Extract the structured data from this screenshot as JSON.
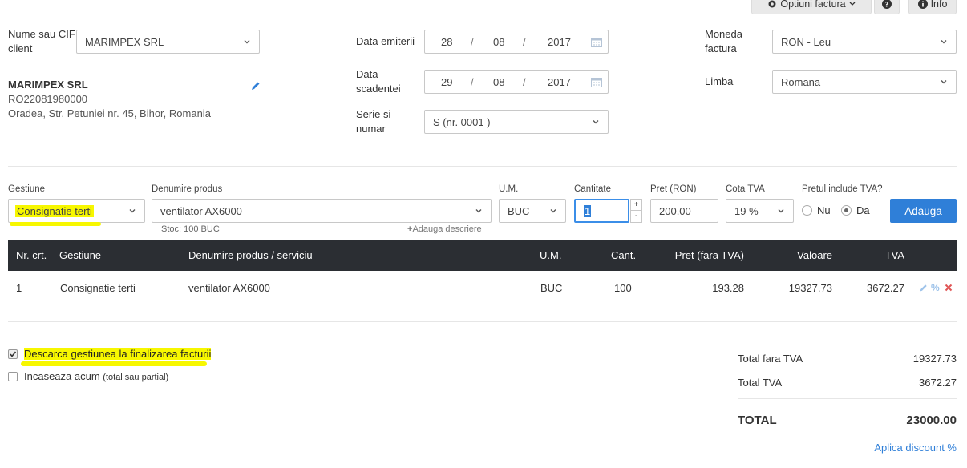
{
  "top": {
    "optiuni_label": "Optiuni factura",
    "info_label": "Info"
  },
  "client": {
    "label_line1": "Nume sau CIF",
    "label_line2": "client",
    "selected": "MARIMPEX SRL",
    "name": "MARIMPEX SRL",
    "cif": "RO22081980000",
    "address": "Oradea, Str. Petuniei nr. 45, Bihor, Romania"
  },
  "dates": {
    "emiterii_label": "Data emiterii",
    "emiterii": {
      "day": "28",
      "month": "08",
      "year": "2017"
    },
    "scadentei_label_line1": "Data",
    "scadentei_label_line2": "scadentei",
    "scadentei": {
      "day": "29",
      "month": "08",
      "year": "2017"
    },
    "sep": "/"
  },
  "serie": {
    "label_line1": "Serie si",
    "label_line2": "numar",
    "value": "S (nr. 0001 )"
  },
  "moneda": {
    "label_line1": "Moneda",
    "label_line2": "factura",
    "value": "RON - Leu"
  },
  "limba": {
    "label": "Limba",
    "value": "Romana"
  },
  "product_form": {
    "gestiune_label": "Gestiune",
    "gestiune_value": "Consignatie terti",
    "denumire_label": "Denumire produs",
    "denumire_value": "ventilator AX6000",
    "stoc": "Stoc: 100 BUC",
    "adauga_descriere": "Adauga descriere",
    "um_label": "U.M.",
    "um_value": "BUC",
    "cantitate_label": "Cantitate",
    "cantitate_value": "1",
    "pret_label": "Pret (RON)",
    "pret_value": "200.00",
    "cota_label": "Cota TVA",
    "cota_value": "19 %",
    "include_label": "Pretul include TVA?",
    "nu": "Nu",
    "da": "Da",
    "adauga_btn": "Adauga"
  },
  "table": {
    "headers": [
      "Nr. crt.",
      "Gestiune",
      "Denumire produs / serviciu",
      "U.M.",
      "Cant.",
      "Pret (fara TVA)",
      "Valoare",
      "TVA"
    ],
    "rows": [
      [
        "1",
        "Consignatie terti",
        "ventilator AX6000",
        "BUC",
        "100",
        "193.28",
        "19327.73",
        "3672.27"
      ]
    ]
  },
  "options": {
    "descarca": "Descarca gestiunea la finalizarea facturii",
    "descarca_checked": true,
    "incaseaza": "Incaseaza acum",
    "incaseaza_note": "(total sau partial)",
    "incaseaza_checked": false
  },
  "totals": {
    "fara_tva_label": "Total fara TVA",
    "fara_tva_value": "19327.73",
    "tva_label": "Total TVA",
    "tva_value": "3672.27",
    "total_label": "TOTAL",
    "total_value": "23000.00",
    "discount_link": "Aplica discount %"
  },
  "colors": {
    "accent": "#2f7fd8",
    "header_bg": "#2b2e33",
    "highlight": "#f7f700",
    "delete": "#e05555"
  }
}
